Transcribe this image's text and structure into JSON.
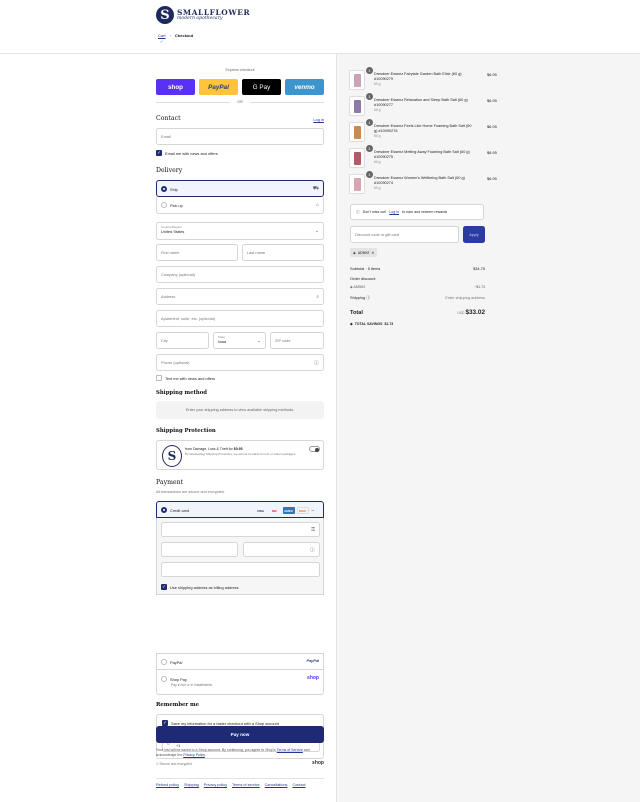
{
  "header": {
    "brand_name": "SMALLFLOWER",
    "brand_tagline": "modern apothecary",
    "logo_letter": "S",
    "breadcrumb": {
      "cart": "Cart",
      "separator": "›",
      "checkout": "Checkout"
    }
  },
  "express": {
    "title": "Express checkout",
    "buttons": [
      {
        "label": "shop",
        "bg": "#5a31f4",
        "fg": "#ffffff"
      },
      {
        "label": "PayPal",
        "bg": "#ffc439",
        "fg": "#253b80"
      },
      {
        "label": "G Pay",
        "bg": "#000000",
        "fg": "#ffffff"
      },
      {
        "label": "venmo",
        "bg": "#3d95ce",
        "fg": "#ffffff"
      }
    ],
    "or": "OR"
  },
  "contact": {
    "title": "Contact",
    "login": "Log in",
    "email_placeholder": "Email",
    "newsletter": "Email me with news and offers"
  },
  "delivery": {
    "title": "Delivery",
    "ship": "Ship",
    "pickup": "Pick up",
    "country_label": "Country/Region",
    "country_value": "United States",
    "first_name": "First name",
    "last_name": "Last name",
    "company": "Company (optional)",
    "address": "Address",
    "apartment": "Apartment, suite, etc. (optional)",
    "city": "City",
    "state_label": "State",
    "state_value": "Iowa",
    "zip": "ZIP code",
    "phone": "Phone (optional)",
    "text_news": "Text me with news and offers"
  },
  "shipping_method": {
    "title": "Shipping method",
    "message": "Enter your shipping address to view available shipping methods."
  },
  "shipping_protection": {
    "title": "Shipping Protection",
    "line1": "from Damage, Loss & Theft for",
    "price": "$0.95",
    "line2": "By Deselecting Shipping Protection, we will not be liable for lost or stolen packages."
  },
  "payment": {
    "title": "Payment",
    "subtitle": "All transactions are secure and encrypted.",
    "credit_card": "Credit card",
    "card_brands": [
      "VISA",
      "MC",
      "AMEX",
      "DISC"
    ],
    "more_icon": "→",
    "billing_same": "Use shipping address as billing address",
    "paypal": "PayPal",
    "paypal_logo": "PayPal",
    "shop_pay": "Shop Pay",
    "shop_pay_sub": "Pay in full or in installments",
    "shop_pay_logo": "shop"
  },
  "remember": {
    "title": "Remember me",
    "save_info": "Save my information for a faster checkout with a Shop account",
    "mobile_label": "Mobile phone number",
    "mobile_value": "+1",
    "secure": "Secure and encrypted",
    "shop_logo": "shop"
  },
  "pay_now": "Pay now",
  "legal": {
    "text1": "Your info will be saved to a Shop account. By continuing, you agree to Shop's",
    "terms": "Terms of Service",
    "text2": "and acknowledge the",
    "privacy": "Privacy Policy",
    "end": "."
  },
  "footer_links": [
    "Refund policy",
    "Shipping",
    "Privacy policy",
    "Terms of service",
    "Cancellations",
    "Contact"
  ],
  "order": {
    "items": [
      {
        "qty": "1",
        "name": "Dresdner Essenz Fairytale Garden Bath Elixir (60 g) #10090279",
        "size": "60 g",
        "price": "$6.95",
        "color": "#c9a3b8"
      },
      {
        "qty": "1",
        "name": "Dresdner Essenz Relaxation and Sleep Bath Salt (60 g) #10090277",
        "size": "60 g",
        "price": "$6.95",
        "color": "#8e7aa8"
      },
      {
        "qty": "1",
        "name": "Dresdner Essenz Feels Like Home Foaming Bath Salt (60 g) #10090276",
        "size": "60 g",
        "price": "$6.95",
        "color": "#c98a4e"
      },
      {
        "qty": "1",
        "name": "Dresdner Essenz Melting Away Foaming Bath Salt (60 g) #10090275",
        "size": "60 g",
        "price": "$6.95",
        "color": "#b35a6a"
      },
      {
        "qty": "1",
        "name": "Dresdner Essenz Women's Wellbeing Bath Salt (60 g) #10090274",
        "size": "60 g",
        "price": "$6.95",
        "color": "#d9a4b3"
      }
    ],
    "rewards_text": "Don't miss out!",
    "rewards_login": "Log in",
    "rewards_rest": "to earn and redeem rewards",
    "discount_placeholder": "Discount code or gift card",
    "apply": "Apply",
    "applied_code": "ADBH2",
    "subtotal_label": "Subtotal · 5 items",
    "subtotal_value": "$34.75",
    "order_discount_label": "Order discount",
    "discount_code": "ADBH2",
    "discount_value": "−$1.73",
    "shipping_label": "Shipping",
    "shipping_value": "Enter shipping address",
    "total_label": "Total",
    "currency": "USD",
    "total_value": "$33.02",
    "savings_label": "TOTAL SAVINGS",
    "savings_value": "$1.73"
  }
}
